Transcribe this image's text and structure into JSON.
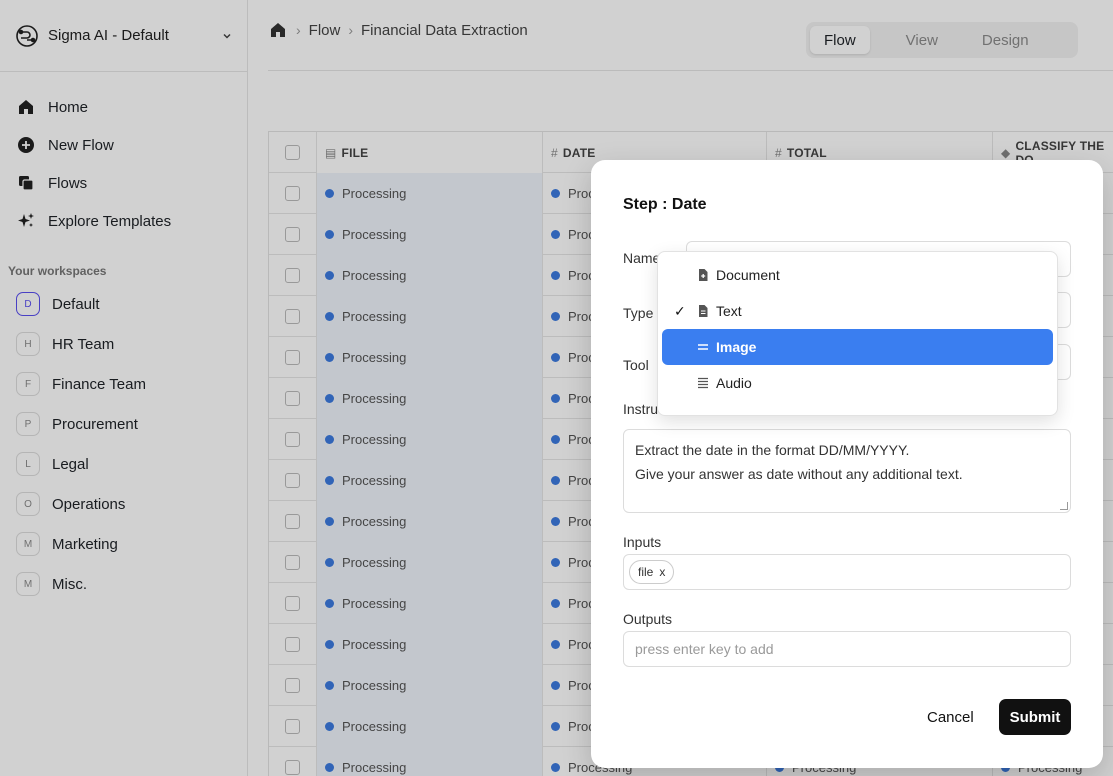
{
  "sidebar": {
    "workspace_title": "Sigma AI - Default",
    "nav": [
      {
        "label": "Home",
        "icon": "home-icon"
      },
      {
        "label": "New Flow",
        "icon": "plus-circle-icon"
      },
      {
        "label": "Flows",
        "icon": "copy-icon"
      },
      {
        "label": "Explore Templates",
        "icon": "sparkles-icon"
      }
    ],
    "workspaces_label": "Your workspaces",
    "workspaces": [
      {
        "initial": "D",
        "label": "Default"
      },
      {
        "initial": "H",
        "label": "HR Team"
      },
      {
        "initial": "F",
        "label": "Finance Team"
      },
      {
        "initial": "P",
        "label": "Procurement"
      },
      {
        "initial": "L",
        "label": "Legal"
      },
      {
        "initial": "O",
        "label": "Operations"
      },
      {
        "initial": "M",
        "label": "Marketing"
      },
      {
        "initial": "M",
        "label": "Misc."
      }
    ]
  },
  "header": {
    "breadcrumb": [
      "Flow",
      "Financial Data Extraction"
    ],
    "tabs": [
      "Flow",
      "View",
      "Design"
    ],
    "active_tab": "Flow"
  },
  "table": {
    "columns": [
      "FILE",
      "DATE",
      "TOTAL",
      "CLASSIFY THE DO"
    ],
    "column_icons": [
      "document-icon",
      "hash-icon",
      "hash-icon",
      "tag-icon"
    ],
    "status_text": "Processing",
    "truncated_text": "Proc"
  },
  "modal": {
    "title": "Step : Date",
    "name_label": "Name",
    "type_label": "Type",
    "tool_label": "Tool",
    "instructions_label": "Instru",
    "instructions_line1": "Extract the  date in the format DD/MM/YYYY.",
    "instructions_line2": "Give your answer as date without any additional text.",
    "inputs_label": "Inputs",
    "input_tag": "file",
    "input_tag_remove": "x",
    "outputs_label": "Outputs",
    "outputs_placeholder": "press enter key to add",
    "cancel_label": "Cancel",
    "submit_label": "Submit"
  },
  "type_dropdown": {
    "options": [
      {
        "label": "Document",
        "icon": "document-plus-icon",
        "checked": false,
        "highlighted": false
      },
      {
        "label": "Text",
        "icon": "text-document-icon",
        "checked": true,
        "highlighted": false
      },
      {
        "label": "Image",
        "icon": "equals-lines-icon",
        "checked": false,
        "highlighted": true
      },
      {
        "label": "Audio",
        "icon": "list-lines-icon",
        "checked": false,
        "highlighted": false
      }
    ],
    "highlight_color": "#3a7ef0"
  },
  "colors": {
    "status_dot": "#3c7be0",
    "active_workspace": "#5a4ff0",
    "submit_bg": "#111111"
  }
}
